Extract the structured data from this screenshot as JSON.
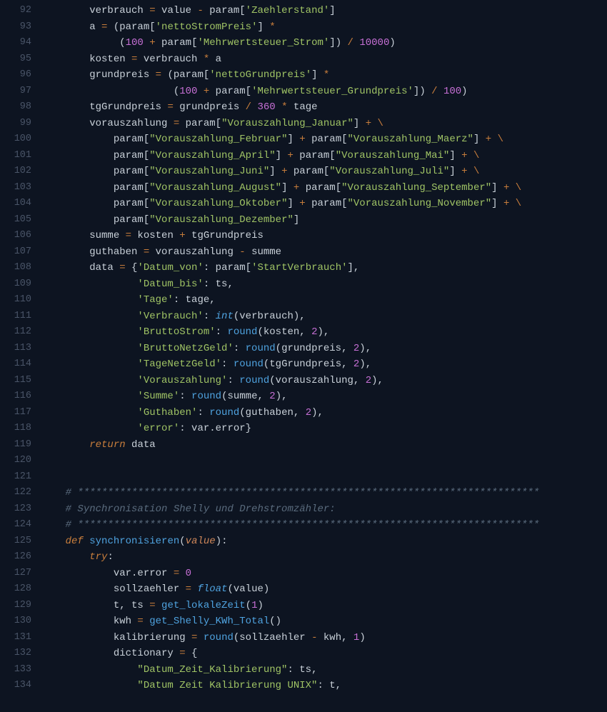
{
  "lines": [
    {
      "num": "92",
      "html": "        verbrauch <span class='op'>=</span> value <span class='op'>-</span> param[<span class='str'>'Zaehlerstand'</span>]"
    },
    {
      "num": "93",
      "html": "        a <span class='op'>=</span> (param[<span class='str'>'nettoStromPreis'</span>] <span class='op'>*</span>"
    },
    {
      "num": "94",
      "html": "             (<span class='num'>100</span> <span class='op'>+</span> param[<span class='str'>'Mehrwertsteuer_Strom'</span>]) <span class='op'>/</span> <span class='num'>10000</span>)"
    },
    {
      "num": "95",
      "html": "        kosten <span class='op'>=</span> verbrauch <span class='op'>*</span> a"
    },
    {
      "num": "96",
      "html": "        grundpreis <span class='op'>=</span> (param[<span class='str'>'nettoGrundpreis'</span>] <span class='op'>*</span>"
    },
    {
      "num": "97",
      "html": "                      (<span class='num'>100</span> <span class='op'>+</span> param[<span class='str'>'Mehrwertsteuer_Grundpreis'</span>]) <span class='op'>/</span> <span class='num'>100</span>)"
    },
    {
      "num": "98",
      "html": "        tgGrundpreis <span class='op'>=</span> grundpreis <span class='op'>/</span> <span class='num'>360</span> <span class='op'>*</span> tage"
    },
    {
      "num": "99",
      "html": "        vorauszahlung <span class='op'>=</span> param[<span class='str'>\"Vorauszahlung_Januar\"</span>] <span class='op'>+</span> <span class='op'>\\</span>"
    },
    {
      "num": "100",
      "html": "            param[<span class='str'>\"Vorauszahlung_Februar\"</span>] <span class='op'>+</span> param[<span class='str'>\"Vorauszahlung_Maerz\"</span>] <span class='op'>+</span> <span class='op'>\\</span>"
    },
    {
      "num": "101",
      "html": "            param[<span class='str'>\"Vorauszahlung_April\"</span>] <span class='op'>+</span> param[<span class='str'>\"Vorauszahlung_Mai\"</span>] <span class='op'>+</span> <span class='op'>\\</span>"
    },
    {
      "num": "102",
      "html": "            param[<span class='str'>\"Vorauszahlung_Juni\"</span>] <span class='op'>+</span> param[<span class='str'>\"Vorauszahlung_Juli\"</span>] <span class='op'>+</span> <span class='op'>\\</span>"
    },
    {
      "num": "103",
      "html": "            param[<span class='str'>\"Vorauszahlung_August\"</span>] <span class='op'>+</span> param[<span class='str'>\"Vorauszahlung_September\"</span>] <span class='op'>+</span> <span class='op'>\\</span>"
    },
    {
      "num": "104",
      "html": "            param[<span class='str'>\"Vorauszahlung_Oktober\"</span>] <span class='op'>+</span> param[<span class='str'>\"Vorauszahlung_November\"</span>] <span class='op'>+</span> <span class='op'>\\</span>"
    },
    {
      "num": "105",
      "html": "            param[<span class='str'>\"Vorauszahlung_Dezember\"</span>]"
    },
    {
      "num": "106",
      "html": "        summe <span class='op'>=</span> kosten <span class='op'>+</span> tgGrundpreis"
    },
    {
      "num": "107",
      "html": "        guthaben <span class='op'>=</span> vorauszahlung <span class='op'>-</span> summe"
    },
    {
      "num": "108",
      "html": "        data <span class='op'>=</span> {<span class='str'>'Datum_von'</span>: param[<span class='str'>'StartVerbrauch'</span>],"
    },
    {
      "num": "109",
      "html": "                <span class='str'>'Datum_bis'</span>: ts,"
    },
    {
      "num": "110",
      "html": "                <span class='str'>'Tage'</span>: tage,"
    },
    {
      "num": "111",
      "html": "                <span class='str'>'Verbrauch'</span>: <span class='builtin'>int</span>(verbrauch),"
    },
    {
      "num": "112",
      "html": "                <span class='str'>'BruttoStrom'</span>: <span class='call'>round</span>(kosten, <span class='num'>2</span>),"
    },
    {
      "num": "113",
      "html": "                <span class='str'>'BruttoNetzGeld'</span>: <span class='call'>round</span>(grundpreis, <span class='num'>2</span>),"
    },
    {
      "num": "114",
      "html": "                <span class='str'>'TageNetzGeld'</span>: <span class='call'>round</span>(tgGrundpreis, <span class='num'>2</span>),"
    },
    {
      "num": "115",
      "html": "                <span class='str'>'Vorauszahlung'</span>: <span class='call'>round</span>(vorauszahlung, <span class='num'>2</span>),"
    },
    {
      "num": "116",
      "html": "                <span class='str'>'Summe'</span>: <span class='call'>round</span>(summe, <span class='num'>2</span>),"
    },
    {
      "num": "117",
      "html": "                <span class='str'>'Guthaben'</span>: <span class='call'>round</span>(guthaben, <span class='num'>2</span>),"
    },
    {
      "num": "118",
      "html": "                <span class='str'>'error'</span>: var.error}"
    },
    {
      "num": "119",
      "html": "        <span class='kw'>return</span> data"
    },
    {
      "num": "120",
      "html": ""
    },
    {
      "num": "121",
      "html": ""
    },
    {
      "num": "122",
      "html": "    <span class='cmt'># *****************************************************************************</span>"
    },
    {
      "num": "123",
      "html": "    <span class='cmt'># Synchronisation Shelly und Drehstromzähler:</span>"
    },
    {
      "num": "124",
      "html": "    <span class='cmt'># *****************************************************************************</span>"
    },
    {
      "num": "125",
      "html": "    <span class='kw'>def</span> <span class='fn'>synchronisieren</span>(<span class='param'>value</span>):"
    },
    {
      "num": "126",
      "html": "        <span class='kw'>try</span>:"
    },
    {
      "num": "127",
      "html": "            var.error <span class='op'>=</span> <span class='num'>0</span>"
    },
    {
      "num": "128",
      "html": "            sollzaehler <span class='op'>=</span> <span class='builtin'>float</span>(value)"
    },
    {
      "num": "129",
      "html": "            t, ts <span class='op'>=</span> <span class='call'>get_lokaleZeit</span>(<span class='num'>1</span>)"
    },
    {
      "num": "130",
      "html": "            kwh <span class='op'>=</span> <span class='call'>get_Shelly_KWh_Total</span>()"
    },
    {
      "num": "131",
      "html": "            kalibrierung <span class='op'>=</span> <span class='call'>round</span>(sollzaehler <span class='op'>-</span> kwh, <span class='num'>1</span>)"
    },
    {
      "num": "132",
      "html": "            dictionary <span class='op'>=</span> {"
    },
    {
      "num": "133",
      "html": "                <span class='str'>\"Datum_Zeit_Kalibrierung\"</span>: ts,"
    },
    {
      "num": "134",
      "html": "                <span class='str'>\"Datum Zeit Kalibrierung UNIX\"</span>: t,"
    }
  ]
}
